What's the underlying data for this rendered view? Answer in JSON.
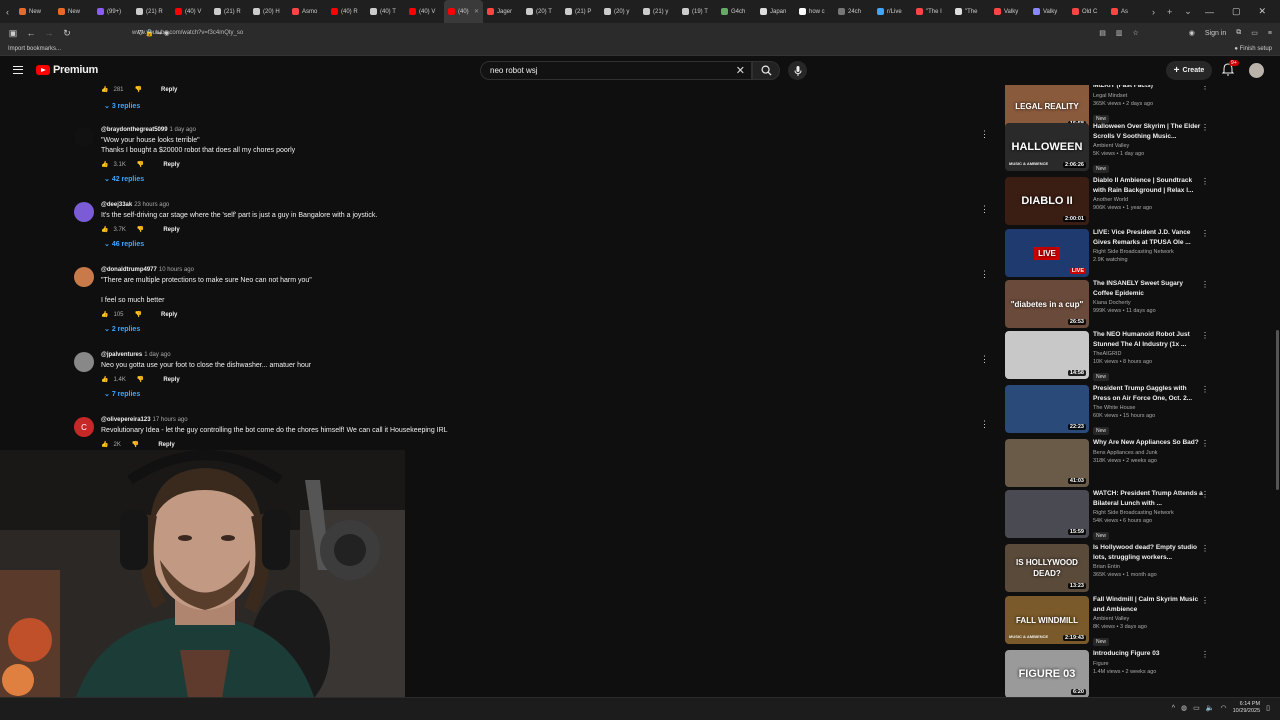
{
  "browser": {
    "tabs": [
      {
        "label": "New",
        "color": "#e66a2a"
      },
      {
        "label": "New",
        "color": "#e66a2a"
      },
      {
        "label": "(99+)",
        "color": "#8b5cf6"
      },
      {
        "label": "(21) R",
        "color": "#cccccc"
      },
      {
        "label": "(40) V",
        "color": "#ff0000"
      },
      {
        "label": "(21) R",
        "color": "#cccccc"
      },
      {
        "label": "(20) H",
        "color": "#cccccc"
      },
      {
        "label": "Asmo",
        "color": "#ff4444"
      },
      {
        "label": "(40) R",
        "color": "#ff0000"
      },
      {
        "label": "(40) T",
        "color": "#cccccc"
      },
      {
        "label": "(40) V",
        "color": "#ff0000"
      },
      {
        "label": "(40)",
        "color": "#ff0000",
        "active": true
      },
      {
        "label": "Jager",
        "color": "#ff4444"
      },
      {
        "label": "(20) T",
        "color": "#cccccc"
      },
      {
        "label": "(21) P",
        "color": "#cccccc"
      },
      {
        "label": "(20) y",
        "color": "#cccccc"
      },
      {
        "label": "(21) y",
        "color": "#cccccc"
      },
      {
        "label": "(19) T",
        "color": "#cccccc"
      },
      {
        "label": "G4ch",
        "color": "#66aa66"
      },
      {
        "label": "Japan",
        "color": "#dddddd"
      },
      {
        "label": "how c",
        "color": "#ffffff"
      },
      {
        "label": "24ch",
        "color": "#777777"
      },
      {
        "label": "r/Live",
        "color": "#3ea6ff"
      },
      {
        "label": "\"The I",
        "color": "#ff4444"
      },
      {
        "label": "\"The",
        "color": "#dddddd"
      },
      {
        "label": "Valky",
        "color": "#ff4444"
      },
      {
        "label": "Valky",
        "color": "#8888ff"
      },
      {
        "label": "Old C",
        "color": "#ff4444"
      },
      {
        "label": "As",
        "color": "#ff4444"
      }
    ],
    "url": "www.youtube.com/watch?v=f3c4mQty_so",
    "import_bookmarks": "Import bookmarks...",
    "sign_in": "Sign in",
    "finish_setup": "Finish setup"
  },
  "header": {
    "logo_text": "Premium",
    "search_value": "neo robot wsj",
    "create_label": "Create",
    "notif_count": "9+"
  },
  "comments": {
    "top_partial": {
      "likes": "281",
      "reply": "Reply",
      "replies": "3 replies"
    },
    "items": [
      {
        "handle": "@braydonthegreat5099",
        "time": "1 day ago",
        "lines": [
          "\"Wow your house looks terrible\"",
          "Thanks I bought a $20000 robot that does all my chores poorly"
        ],
        "likes": "3.1K",
        "reply": "Reply",
        "replies": "42 replies",
        "avatar": "#111111"
      },
      {
        "handle": "@deej33ak",
        "time": "23 hours ago",
        "lines": [
          "It's the self-driving car stage where the 'self' part is just a guy in Bangalore with a joystick."
        ],
        "likes": "3.7K",
        "reply": "Reply",
        "replies": "46 replies",
        "avatar": "#7b5cd6"
      },
      {
        "handle": "@donaldtrump4977",
        "time": "10 hours ago",
        "lines": [
          "\"There are multiple protections to make sure Neo can not harm you\"",
          "",
          "I feel so much better"
        ],
        "likes": "105",
        "reply": "Reply",
        "replies": "2 replies",
        "avatar": "#c97a4a"
      },
      {
        "handle": "@jpalventures",
        "time": "1 day ago",
        "lines": [
          "Neo you gotta use your foot to close the dishwasher... amatuer hour"
        ],
        "likes": "1.4K",
        "reply": "Reply",
        "replies": "7 replies",
        "avatar": "#888888"
      },
      {
        "handle": "@olivepereira123",
        "time": "17 hours ago",
        "lines": [
          "Revolutionary Idea - let the guy controlling the bot come do the chores himself! We can call it Housekeeping IRL"
        ],
        "likes": "2K",
        "reply": "Reply",
        "replies": "",
        "avatar": "#c62828",
        "initial": "C"
      }
    ]
  },
  "sidebar": {
    "videos": [
      {
        "title": "MIZKIT (Fast Facts)",
        "channel": "Legal Mindset",
        "meta": "365K views • 2 days ago",
        "new": "New",
        "duration": "15:58",
        "thumb_text": "LEGAL REALITY",
        "thumb_bg": "#8a5a3c"
      },
      {
        "title": "Halloween Over Skyrim | The Elder Scrolls V Soothing Music...",
        "channel": "Ambient Valley",
        "meta": "5K views • 1 day ago",
        "new": "New",
        "duration": "2:06:26",
        "thumb_text": "HALLOWEEN",
        "thumb_sub": "MUSIC & AMBIENCE",
        "thumb_bg": "#2a2a2a"
      },
      {
        "title": "Diablo II Ambience | Soundtrack with Rain Background | Relax l...",
        "channel": "Another World",
        "meta": "906K views • 1 year ago",
        "new": "",
        "duration": "2:00:01",
        "thumb_text": "DIABLO II",
        "thumb_bg": "#3a1e14"
      },
      {
        "title": "LIVE: Vice President J.D. Vance Gives Remarks at TPUSA Ole ...",
        "channel": "Right Side Broadcasting Network",
        "meta": "2.9K watching",
        "new": "",
        "duration": "LIVE",
        "thumb_text": "LIVE",
        "thumb_bg": "#1e3a6e"
      },
      {
        "title": "The INSANELY Sweet Sugary Coffee Epidemic",
        "channel": "Kiana Docherty",
        "meta": "999K views • 11 days ago",
        "new": "",
        "duration": "26:53",
        "thumb_text": "\"diabetes in a cup\"",
        "thumb_bg": "#6a4a3a"
      },
      {
        "title": "The NEO Humanoid Robot Just Stunned The AI Industry (1x ...",
        "channel": "TheAIGRID",
        "meta": "10K views • 8 hours ago",
        "new": "New",
        "duration": "14:58",
        "thumb_text": "",
        "thumb_bg": "#c8c8c8"
      },
      {
        "title": "President Trump Gaggles with Press on Air Force One, Oct. 2...",
        "channel": "The White House",
        "meta": "60K views • 15 hours ago",
        "new": "New",
        "duration": "22:23",
        "thumb_text": "",
        "thumb_bg": "#2a4a7a"
      },
      {
        "title": "Why Are New Appliances So Bad?",
        "channel": "Bens Appliances and Junk",
        "meta": "318K views • 2 weeks ago",
        "new": "",
        "duration": "41:03",
        "thumb_text": "",
        "thumb_bg": "#6a5a48"
      },
      {
        "title": "WATCH: President Trump Attends a Bilateral Lunch with ...",
        "channel": "Right Side Broadcasting Network",
        "meta": "54K views • 6 hours ago",
        "new": "New",
        "duration": "15:59",
        "thumb_text": "",
        "thumb_bg": "#4a4a52"
      },
      {
        "title": "Is Hollywood dead? Empty studio lots, struggling workers...",
        "channel": "Brian Entin",
        "meta": "365K views • 1 month ago",
        "new": "",
        "duration": "13:23",
        "thumb_text": "IS HOLLYWOOD DEAD?",
        "thumb_bg": "#5a4a3a"
      },
      {
        "title": "Fall Windmill | Calm Skyrim Music and Ambience",
        "channel": "Ambient Valley",
        "meta": "8K views • 3 days ago",
        "new": "New",
        "duration": "2:19:43",
        "thumb_text": "FALL WINDMILL",
        "thumb_sub": "MUSIC & AMBIENCE",
        "thumb_bg": "#7a5a2a"
      },
      {
        "title": "Introducing Figure 03",
        "channel": "Figure",
        "meta": "1.4M views • 2 weeks ago",
        "new": "",
        "duration": "6:20",
        "thumb_text": "FIGURE 03",
        "thumb_bg": "#9a9a9a"
      }
    ]
  },
  "taskbar": {
    "time": "6:14 PM",
    "date": "10/29/2025"
  }
}
